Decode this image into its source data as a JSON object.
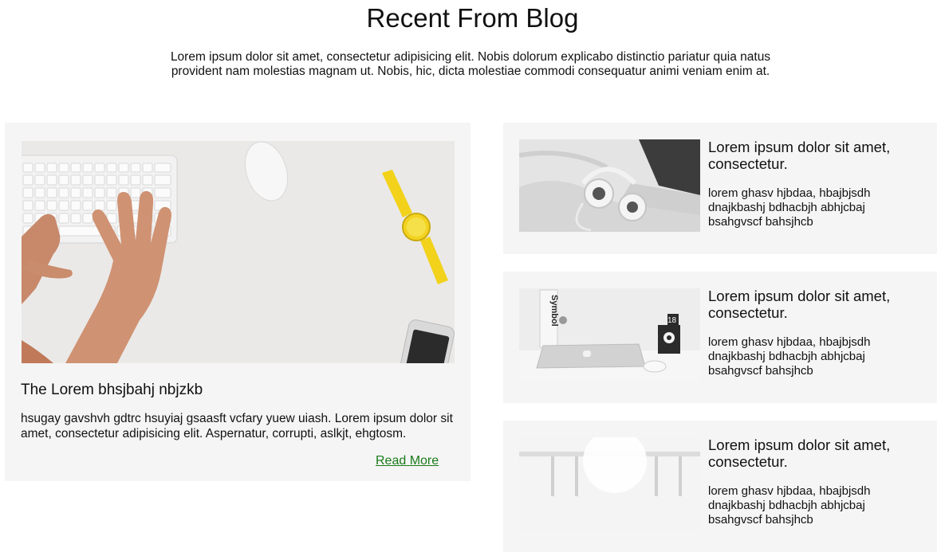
{
  "section": {
    "title": "Recent From Blog",
    "intro": "Lorem ipsum dolor sit amet, consectetur adipisicing elit. Nobis dolorum explicabo distinctio pariatur quia natus provident nam molestias magnam ut. Nobis, hic, dicta molestiae commodi consequatur animi veniam enim at."
  },
  "featured": {
    "title": "The Lorem bhsjbahj nbjzkb",
    "excerpt": "hsugay gavshvh gdtrc hsuyiaj gsaasft vcfary yuew uiash. Lorem ipsum dolor sit amet, consectetur adipisicing elit. Aspernatur, corrupti, aslkjt, ehgtosm.",
    "read_more": "Read More",
    "image": "workspace-keyboard-watch-photo"
  },
  "side_posts": [
    {
      "title": "Lorem ipsum dolor sit amet, consectetur.",
      "excerpt": "lorem ghasv hjbdaa, hbajbjsdh dnajkbashj bdhacbjh abhjcbaj bsahgvscf bahsjhcb",
      "image": "headphones-laptop-photo"
    },
    {
      "title": "Lorem ipsum dolor sit amet, consectetur.",
      "excerpt": "lorem ghasv hjbdaa, hbajbjsdh dnajkbashj bdhacbjh abhjcbaj bsahgvscf bahsjhcb",
      "image": "laptop-desk-photo",
      "image_text": {
        "book": "Symbol",
        "calendar": "18"
      }
    },
    {
      "title": "Lorem ipsum dolor sit amet, consectetur.",
      "excerpt": "lorem ghasv hjbdaa, hbajbjsdh dnajkbashj bdhacbjh abhjcbaj bsahgvscf bahsjhcb",
      "image": "bright-window-photo"
    }
  ],
  "colors": {
    "card_bg": "#f5f5f5",
    "link": "#1a7a1a",
    "watch": "#f2d21a"
  }
}
